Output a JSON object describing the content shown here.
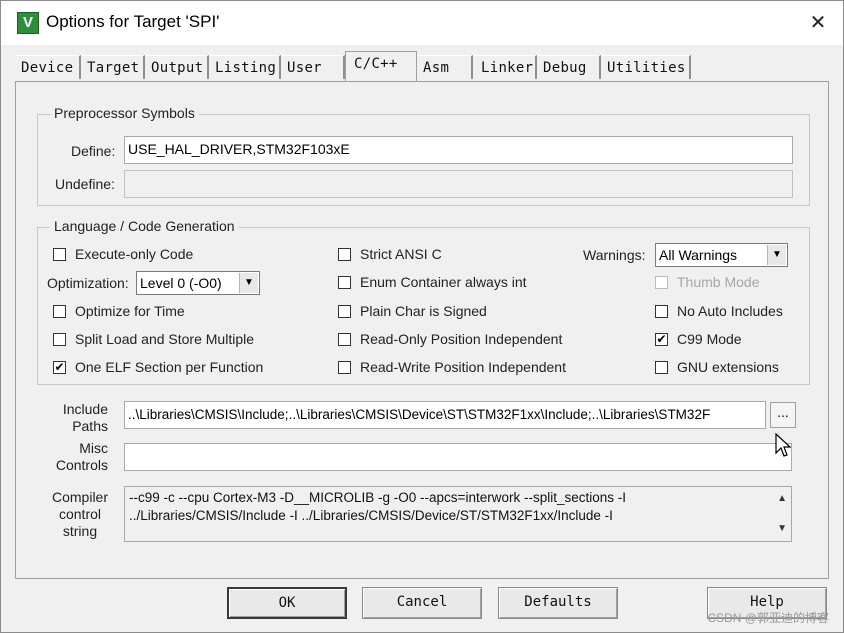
{
  "window": {
    "title": "Options for Target 'SPI'",
    "close_glyph": "✕",
    "icon": "keil-app-icon"
  },
  "tabs": [
    {
      "label": "Device"
    },
    {
      "label": "Target"
    },
    {
      "label": "Output"
    },
    {
      "label": "Listing"
    },
    {
      "label": "User"
    },
    {
      "label": "C/C++",
      "active": true
    },
    {
      "label": "Asm"
    },
    {
      "label": "Linker"
    },
    {
      "label": "Debug"
    },
    {
      "label": "Utilities"
    }
  ],
  "preprocessor": {
    "title": "Preprocessor Symbols",
    "define_label": "Define:",
    "define_value": "USE_HAL_DRIVER,STM32F103xE",
    "undefine_label": "Undefine:",
    "undefine_value": ""
  },
  "language": {
    "title": "Language / Code Generation",
    "execute_only": {
      "label": "Execute-only Code",
      "checked": false
    },
    "optimization_label": "Optimization:",
    "optimization_value": "Level 0 (-O0)",
    "optimize_time": {
      "label": "Optimize for Time",
      "checked": false
    },
    "split_load": {
      "label": "Split Load and Store Multiple",
      "checked": false
    },
    "one_elf": {
      "label": "One ELF Section per Function",
      "checked": true,
      "mark": "✔"
    },
    "strict_ansi": {
      "label": "Strict ANSI C",
      "checked": false
    },
    "enum_container": {
      "label": "Enum Container always int",
      "checked": false
    },
    "plain_char": {
      "label": "Plain Char is Signed",
      "checked": false
    },
    "ro_pi": {
      "label": "Read-Only Position Independent",
      "checked": false
    },
    "rw_pi": {
      "label": "Read-Write Position Independent",
      "checked": false
    },
    "warnings_label": "Warnings:",
    "warnings_value": "All Warnings",
    "thumb_mode": {
      "label": "Thumb Mode",
      "checked": false,
      "disabled": true
    },
    "no_auto_includes": {
      "label": "No Auto Includes",
      "checked": false
    },
    "c99_mode": {
      "label": "C99 Mode",
      "checked": true,
      "mark": "✔"
    },
    "gnu_ext": {
      "label": "GNU extensions",
      "checked": false
    }
  },
  "include": {
    "label_line1": "Include",
    "label_line2": "Paths",
    "value": "..\\Libraries\\CMSIS\\Include;..\\Libraries\\CMSIS\\Device\\ST\\STM32F1xx\\Include;..\\Libraries\\STM32F",
    "browse_label": "..."
  },
  "misc": {
    "label_line1": "Misc",
    "label_line2": "Controls",
    "value": ""
  },
  "compiler": {
    "label_line1": "Compiler",
    "label_line2": "control",
    "label_line3": "string",
    "line1": "--c99 -c --cpu Cortex-M3 -D__MICROLIB -g -O0 --apcs=interwork --split_sections -I",
    "line2": "../Libraries/CMSIS/Include -I ../Libraries/CMSIS/Device/ST/STM32F1xx/Include -I",
    "scroll_up": "▲",
    "scroll_down": "▼"
  },
  "buttons": {
    "ok": "OK",
    "cancel": "Cancel",
    "defaults": "Defaults",
    "help": "Help"
  },
  "watermark": "CSDN @郭亚迪的博客",
  "dropdown_arrow": "▼"
}
